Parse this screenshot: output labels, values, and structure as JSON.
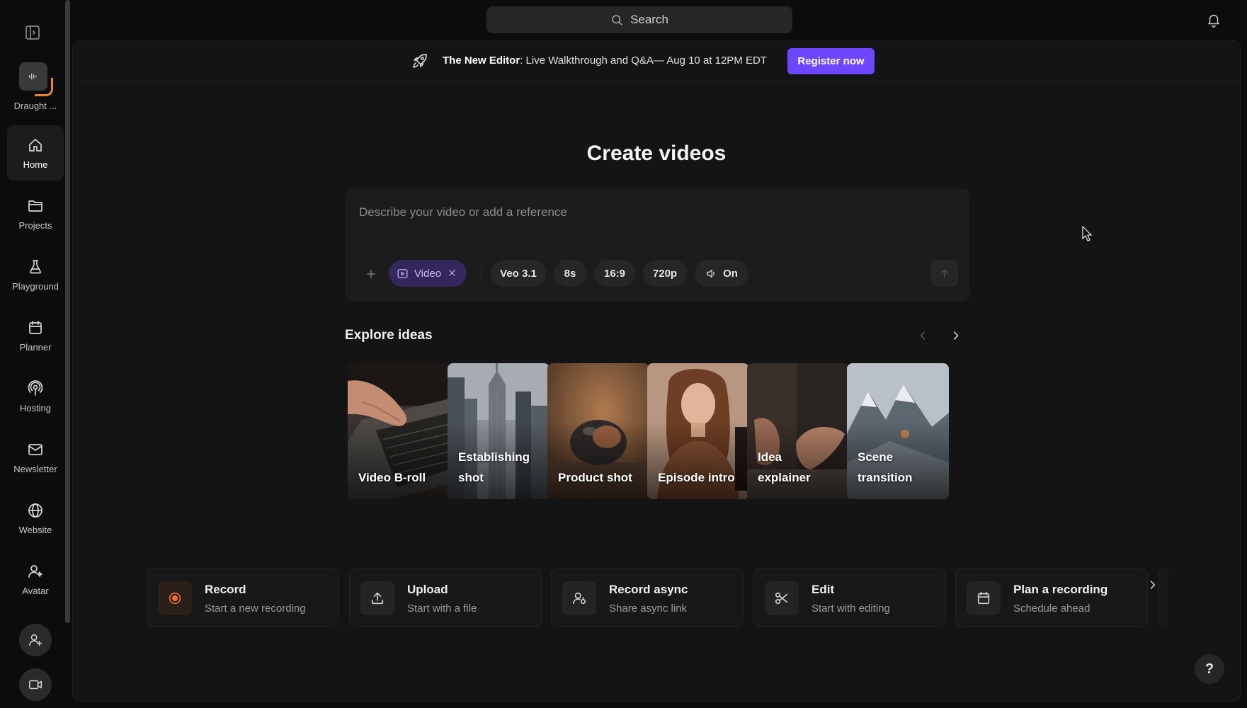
{
  "sidebar": {
    "workspace_name": "Draught ...",
    "items": [
      {
        "label": "Home",
        "icon": "home-icon",
        "active": true
      },
      {
        "label": "Projects",
        "icon": "folder-icon"
      },
      {
        "label": "Playground",
        "icon": "flask-icon"
      },
      {
        "label": "Planner",
        "icon": "calendar-icon"
      },
      {
        "label": "Hosting",
        "icon": "podcast-icon"
      },
      {
        "label": "Newsletter",
        "icon": "mail-icon"
      },
      {
        "label": "Website",
        "icon": "globe-icon"
      },
      {
        "label": "Avatar",
        "icon": "user-sparkle-icon"
      }
    ],
    "bottom_buttons": [
      "add-user-icon",
      "video-camera-icon"
    ]
  },
  "search": {
    "placeholder": "Search"
  },
  "banner": {
    "title": "The New Editor",
    "text": ": Live Walkthrough and Q&A— Aug 10 at 12PM EDT",
    "button": "Register now"
  },
  "create": {
    "title": "Create videos",
    "placeholder": "Describe your video or add a reference",
    "chips": {
      "video": "Video",
      "model": "Veo 3.1",
      "duration": "8s",
      "aspect": "16:9",
      "resolution": "720p",
      "audio": "On"
    }
  },
  "explore": {
    "title": "Explore ideas",
    "cards": [
      {
        "label": "Video B-roll"
      },
      {
        "label": "Establishing\nshot"
      },
      {
        "label": "Product shot"
      },
      {
        "label": "Episode intro"
      },
      {
        "label": "Idea\nexplainer"
      },
      {
        "label": "Scene\ntransition"
      }
    ]
  },
  "actions": [
    {
      "title": "Record",
      "subtitle": "Start a new recording",
      "icon": "record-icon"
    },
    {
      "title": "Upload",
      "subtitle": "Start with a file",
      "icon": "upload-icon"
    },
    {
      "title": "Record async",
      "subtitle": "Share async link",
      "icon": "user-share-icon"
    },
    {
      "title": "Edit",
      "subtitle": "Start with editing",
      "icon": "scissors-icon"
    },
    {
      "title": "Plan a recording",
      "subtitle": "Schedule ahead",
      "icon": "calendar-icon"
    }
  ],
  "help": {
    "label": "?"
  },
  "colors": {
    "accent": "#6c47ff",
    "record": "#f06a2c",
    "video_chip_bg": "#33275c"
  }
}
